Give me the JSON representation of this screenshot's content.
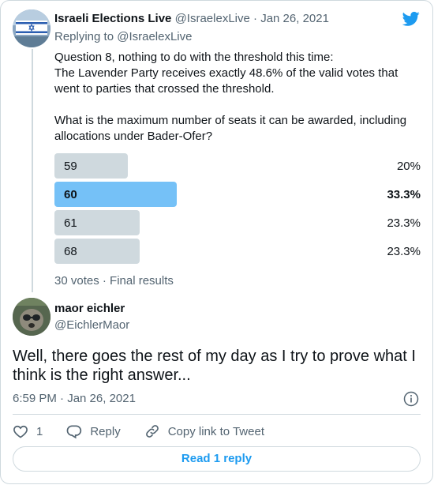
{
  "tweet": {
    "author_name": "Israeli Elections Live",
    "author_handle": "@IsraelexLive",
    "date_sep": " · ",
    "date": "Jan 26, 2021",
    "replying_prefix": "Replying to ",
    "replying_handle": "@IsraelexLive",
    "text": "Question 8, nothing to do with the threshold this time:\nThe Lavender Party receives exactly 48.6% of the valid votes that went to parties that crossed the threshold.\n\nWhat is the maximum number of seats it can be awarded, including allocations under Bader-Ofer?",
    "poll": {
      "options": [
        {
          "label": "59",
          "percent": "20%",
          "fraction": 0.2,
          "winner": false
        },
        {
          "label": "60",
          "percent": "33.3%",
          "fraction": 0.333,
          "winner": true
        },
        {
          "label": "61",
          "percent": "23.3%",
          "fraction": 0.233,
          "winner": false
        },
        {
          "label": "68",
          "percent": "23.3%",
          "fraction": 0.233,
          "winner": false
        }
      ],
      "footer": "30 votes · Final results"
    }
  },
  "reply": {
    "author_name": "maor eichler",
    "author_handle": "@EichlerMaor",
    "text": "Well, there goes the rest of my day as I try to prove what I think is the right answer...",
    "timestamp": "6:59 PM · Jan 26, 2021",
    "like_count": "1",
    "reply_label": "Reply",
    "copy_label": "Copy link to Tweet",
    "read_replies": "Read 1 reply"
  },
  "colors": {
    "accent": "#1d9bf0",
    "winner_bar": "#75c1f7",
    "bar": "#cfd9de",
    "muted": "#536471"
  },
  "icons": [
    "twitter-bird-icon",
    "info-icon",
    "heart-icon",
    "reply-icon",
    "link-icon"
  ]
}
